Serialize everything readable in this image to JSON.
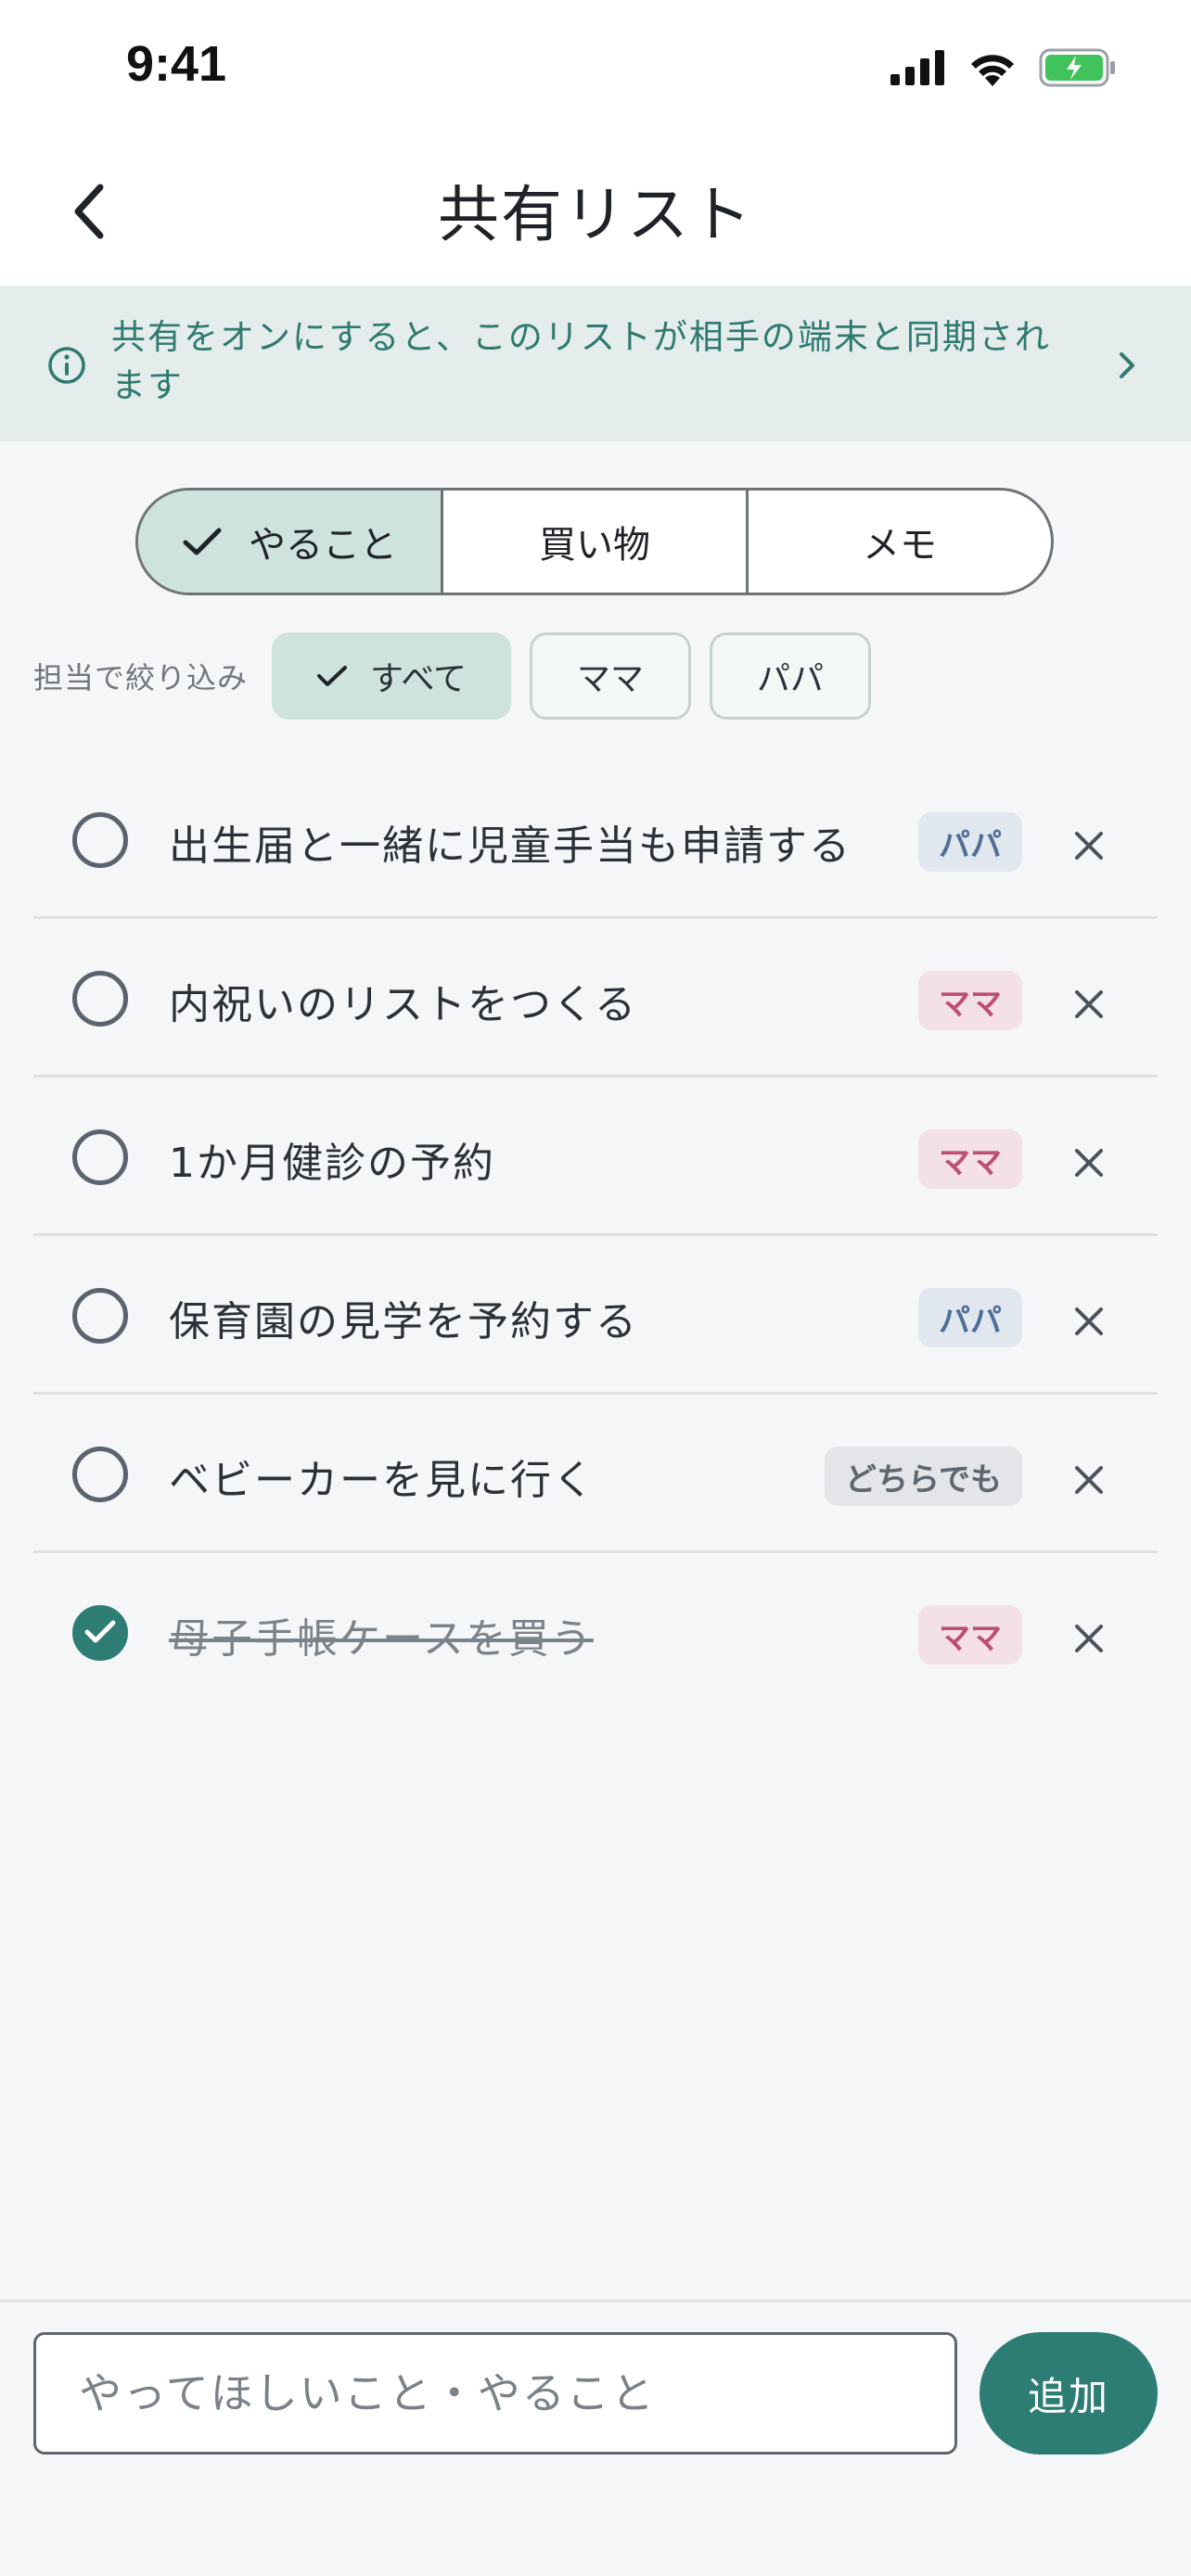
{
  "status_bar": {
    "time": "9:41"
  },
  "nav": {
    "title": "共有リスト"
  },
  "banner": {
    "text": "共有をオンにすると、このリストが相手の端末と同期されます"
  },
  "tabs": [
    {
      "label": "やること",
      "active": true
    },
    {
      "label": "買い物",
      "active": false
    },
    {
      "label": "メモ",
      "active": false
    }
  ],
  "filter": {
    "label": "担当で絞り込み",
    "options": [
      {
        "label": "すべて",
        "active": true
      },
      {
        "label": "ママ",
        "active": false
      },
      {
        "label": "パパ",
        "active": false
      }
    ]
  },
  "tasks": [
    {
      "text": "出生届と一緒に児童手当も申請する",
      "assignee": "パパ",
      "done": false
    },
    {
      "text": "内祝いのリストをつくる",
      "assignee": "ママ",
      "done": false
    },
    {
      "text": "1か月健診の予約",
      "assignee": "ママ",
      "done": false
    },
    {
      "text": "保育園の見学を予約する",
      "assignee": "パパ",
      "done": false
    },
    {
      "text": "ベビーカーを見に行く",
      "assignee": "どちらでも",
      "done": false
    },
    {
      "text": "母子手帳ケースを買う",
      "assignee": "ママ",
      "done": true
    }
  ],
  "composer": {
    "placeholder": "やってほしいこと・やること",
    "add_label": "追加"
  },
  "colors": {
    "accent": "#2e7d74",
    "mama": "#bf4e73",
    "papa": "#4f6f96",
    "banner_bg": "#e4ecec"
  },
  "icons": [
    "back-chevron-icon",
    "info-icon",
    "chevron-right-icon",
    "checkmark-icon",
    "close-icon",
    "signal-icon",
    "wifi-icon",
    "battery-icon"
  ]
}
